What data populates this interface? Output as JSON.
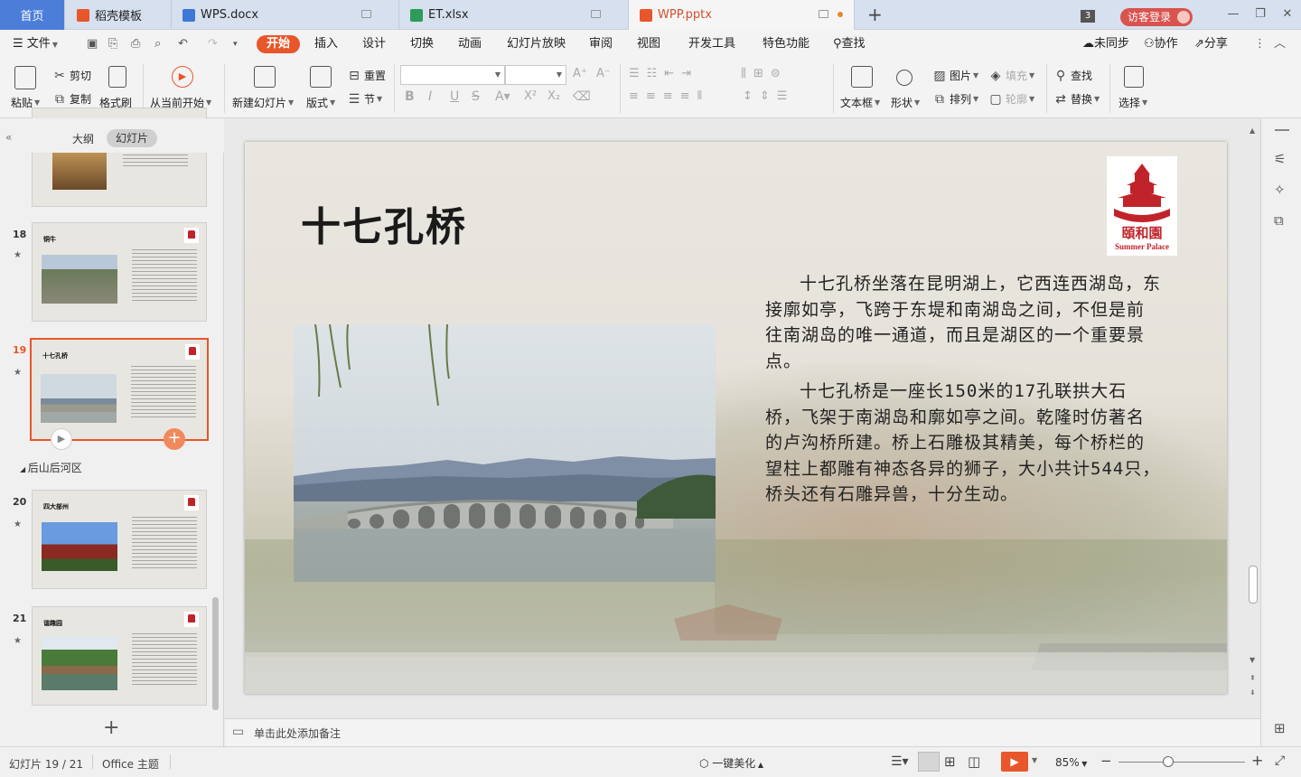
{
  "tabs": {
    "home": "首页",
    "items": [
      {
        "label": "稻壳模板",
        "color": "#e8562b"
      },
      {
        "label": "WPS.docx",
        "color": "#3f77d6"
      },
      {
        "label": "ET.xlsx",
        "color": "#2d9b5a"
      },
      {
        "label": "WPP.pptx",
        "color": "#e8562b"
      }
    ],
    "add": "+",
    "badge": "3",
    "login": "访客登录"
  },
  "menu": {
    "file": "文件",
    "items": [
      "开始",
      "插入",
      "设计",
      "切换",
      "动画",
      "幻灯片放映",
      "审阅",
      "视图",
      "开发工具",
      "特色功能"
    ],
    "search": "查找",
    "sync": "未同步",
    "collab": "协作",
    "share": "分享"
  },
  "ribbon": {
    "paste": "粘贴",
    "cut": "剪切",
    "copy": "复制",
    "format_painter": "格式刷",
    "from_current": "从当前开始",
    "new_slide": "新建幻灯片",
    "layout": "版式",
    "reset": "重置",
    "section": "节",
    "textbox": "文本框",
    "shape": "形状",
    "picture": "图片",
    "arrange": "排列",
    "fill": "填充",
    "outline": "轮廓",
    "find": "查找",
    "replace": "替换",
    "select": "选择"
  },
  "panel": {
    "outline_tab": "大纲",
    "slides_tab": "幻灯片",
    "section_name": "后山后河区",
    "slides": [
      {
        "num": "18",
        "title": "铜牛"
      },
      {
        "num": "19",
        "title": "十七孔桥"
      },
      {
        "num": "20",
        "title": "四大部州"
      },
      {
        "num": "21",
        "title": "谐趣园"
      }
    ],
    "add": "+"
  },
  "slide": {
    "title": "十七孔桥",
    "para1": "十七孔桥坐落在昆明湖上，它西连西湖岛，东接廓如亭，飞跨于东堤和南湖岛之间，不但是前往南湖岛的唯一通道，而且是湖区的一个重要景点。",
    "para2": "十七孔桥是一座长150米的17孔联拱大石桥，飞架于南湖岛和廓如亭之间。乾隆时仿著名的卢沟桥所建。桥上石雕极其精美，每个桥栏的望柱上都雕有神态各异的狮子，大小共计544只，桥头还有石雕异兽，十分生动。",
    "logo_cn": "頤和園",
    "logo_en": "Summer Palace"
  },
  "notes": {
    "placeholder": "单击此处添加备注"
  },
  "status": {
    "slide_count": "幻灯片 19 / 21",
    "theme": "Office 主题",
    "beautify": "一键美化",
    "zoom": "85%"
  },
  "colors": {
    "accent": "#e8562b",
    "home_tab": "#4a7ed8",
    "logo_red": "#c0242a"
  }
}
